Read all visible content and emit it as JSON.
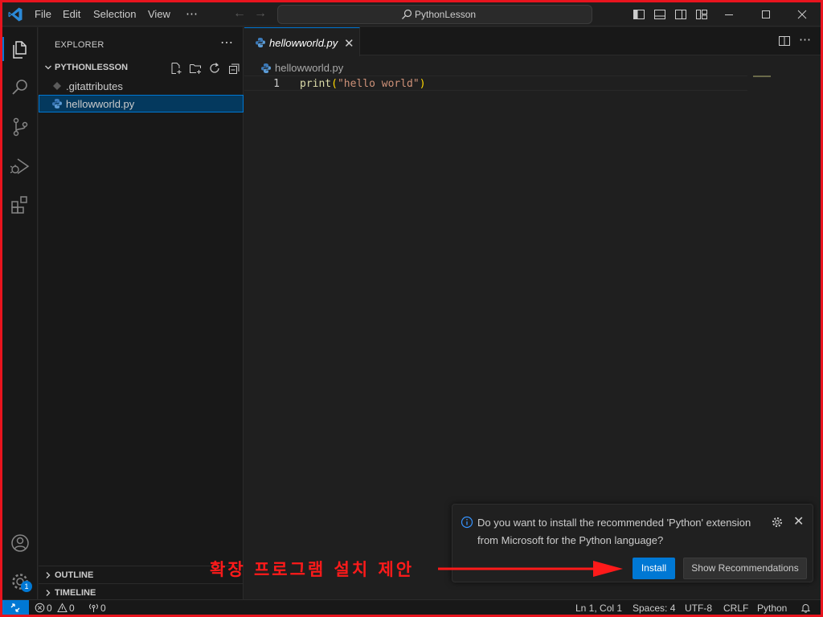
{
  "titlebar": {
    "menu": [
      "File",
      "Edit",
      "Selection",
      "View",
      "⋯"
    ],
    "search_text": "PythonLesson"
  },
  "activitybar": {
    "account_badge": "1"
  },
  "sidebar": {
    "title": "EXPLORER",
    "more": "⋯",
    "folder": "PYTHONLESSON",
    "files": [
      {
        "name": ".gitattributes",
        "icon": "git-file-icon"
      },
      {
        "name": "hellowworld.py",
        "icon": "python-file-icon",
        "selected": true
      }
    ],
    "sections": [
      "OUTLINE",
      "TIMELINE"
    ]
  },
  "editor": {
    "tab_label": "hellowworld.py",
    "breadcrumb": "hellowworld.py",
    "lines": [
      {
        "number": "1",
        "fn": "print",
        "open": "(",
        "str": "\"hello world\"",
        "close": ")"
      }
    ]
  },
  "notification": {
    "message": "Do you want to install the recommended 'Python' extension from Microsoft for the Python language?",
    "install_label": "Install",
    "show_label": "Show Recommendations"
  },
  "annotation": {
    "text": "확장 프로그램 설치 제안",
    "color": "#ff1a1a"
  },
  "statusbar": {
    "errors": "0",
    "warnings": "0",
    "ports": "0",
    "position": "Ln 1, Col 1",
    "spaces": "Spaces: 4",
    "encoding": "UTF-8",
    "eol": "CRLF",
    "language": "Python"
  },
  "colors": {
    "accent": "#0078d4",
    "frame_border": "#e8141e",
    "background": "#1f1f1f"
  }
}
